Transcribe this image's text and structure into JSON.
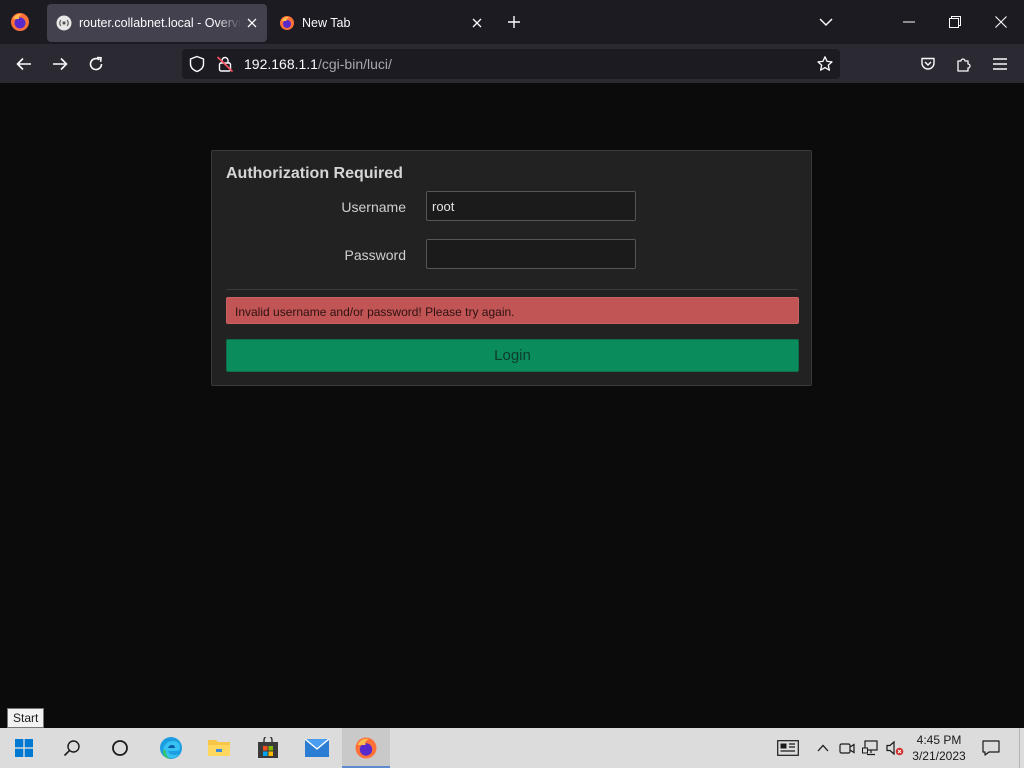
{
  "browser": {
    "tabs": [
      {
        "title": "router.collabnet.local - Overview",
        "active": true
      },
      {
        "title": "New Tab",
        "active": false
      }
    ],
    "url": {
      "host": "192.168.1.1",
      "path": "/cgi-bin/luci/"
    }
  },
  "login": {
    "title": "Authorization Required",
    "username_label": "Username",
    "username_value": "root",
    "password_label": "Password",
    "password_value": "",
    "error_message": "Invalid username and/or password! Please try again.",
    "login_button": "Login"
  },
  "taskbar": {
    "start_tooltip": "Start",
    "clock_time": "4:45 PM",
    "clock_date": "3/21/2023"
  },
  "colors": {
    "error_bg": "#c15454",
    "login_button_bg": "#0b8c5d",
    "panel_bg": "#222222",
    "page_bg": "#0b0b0b"
  }
}
